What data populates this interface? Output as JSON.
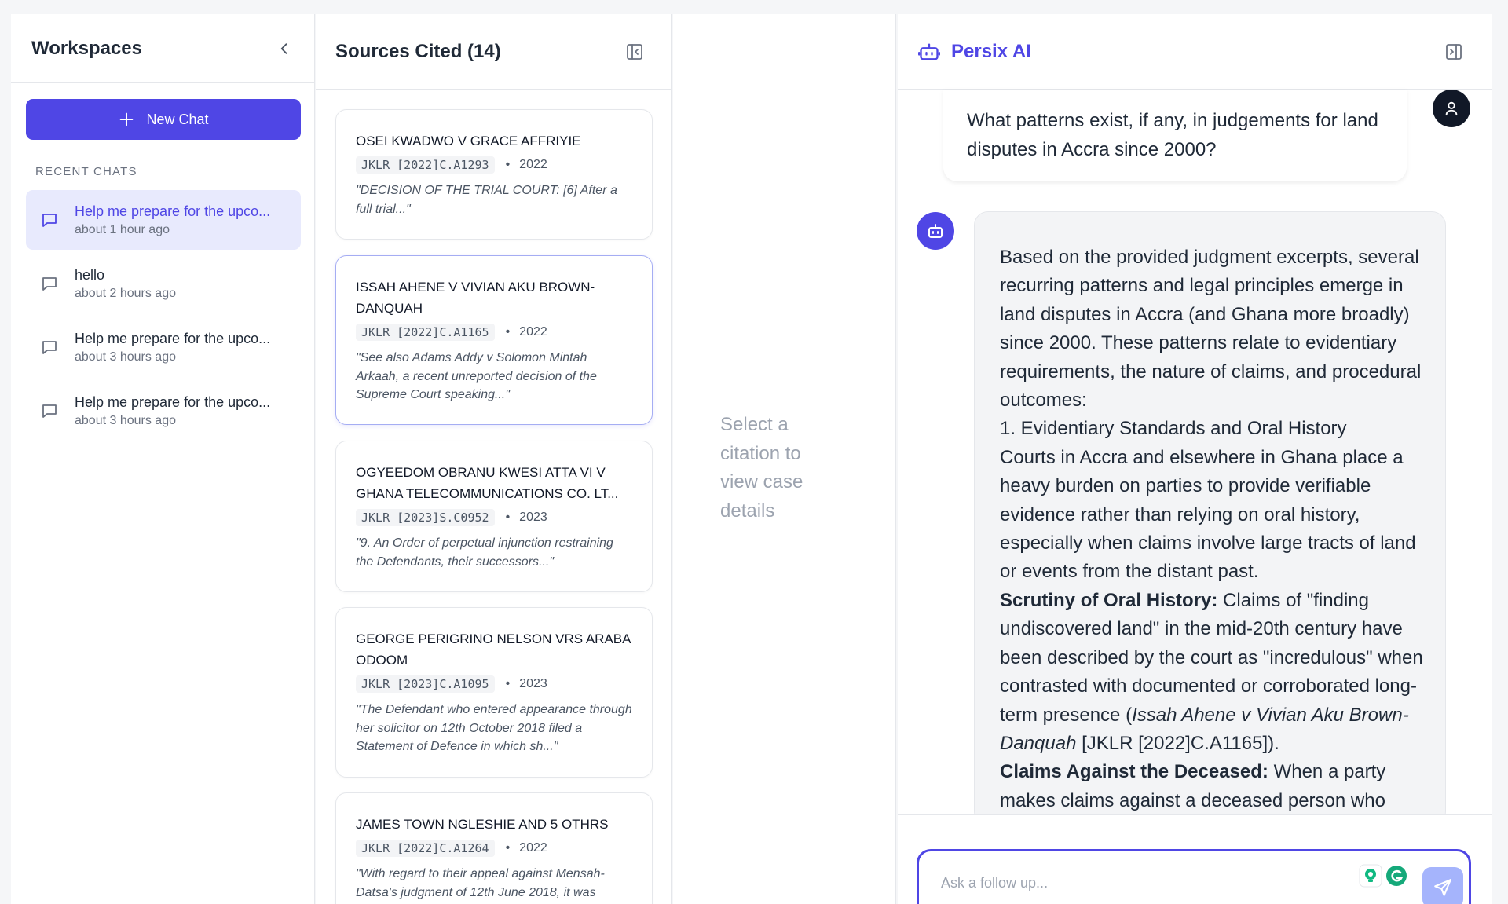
{
  "sidebar": {
    "title": "Workspaces",
    "new_chat_label": "New Chat",
    "recent_label": "RECENT CHATS",
    "chats": [
      {
        "title": "Help me prepare for the upco...",
        "time": "about 1 hour ago",
        "active": true
      },
      {
        "title": "hello",
        "time": "about 2 hours ago",
        "active": false
      },
      {
        "title": "Help me prepare for the upco...",
        "time": "about 3 hours ago",
        "active": false
      },
      {
        "title": "Help me prepare for the upco...",
        "time": "about 3 hours ago",
        "active": false
      }
    ]
  },
  "sources": {
    "title": "Sources Cited (14)",
    "cards": [
      {
        "title": "OSEI KWADWO V GRACE AFFRIYIE",
        "citation": "JKLR [2022]C.A1293",
        "year": "2022",
        "quote": "\"DECISION OF THE TRIAL COURT: [6] After a full trial...\""
      },
      {
        "title": "ISSAH AHENE V VIVIAN AKU BROWN-DANQUAH",
        "citation": "JKLR [2022]C.A1165",
        "year": "2022",
        "quote": "\"See also Adams Addy v Solomon Mintah Arkaah, a recent unreported decision of the Supreme Court speaking...\""
      },
      {
        "title": "OGYEEDOM OBRANU KWESI ATTA VI v GHANA TELECOMMUNICATIONS CO. LT...",
        "citation": "JKLR [2023]S.C0952",
        "year": "2023",
        "quote": "\"9. An Order of perpetual injunction restraining the Defendants, their successors...\""
      },
      {
        "title": "GEORGE PERIGRINO NELSON VRS ARABA ODOOM",
        "citation": "JKLR [2023]C.A1095",
        "year": "2023",
        "quote": "\"The Defendant who entered appearance through her solicitor on 12th October 2018 filed a Statement of Defence in which sh...\""
      },
      {
        "title": "JAMES TOWN NGLESHIE AND 5 OTHRS",
        "citation": "JKLR [2022]C.A1264",
        "year": "2022",
        "quote": "\"With regard to their appeal against Mensah-Datsa's judgment of 12th June 2018, it was"
      }
    ]
  },
  "detail": {
    "empty_message": "Select a citation to view case details"
  },
  "chat": {
    "brand": "Persix AI",
    "user_message": "What patterns exist, if any, in judgements for land disputes in Accra since 2000?",
    "answer": {
      "intro": "Based on the provided judgment excerpts, several recurring patterns and legal principles emerge in land disputes in Accra (and Ghana more broadly) since 2000. These patterns relate to evidentiary requirements, the nature of claims, and procedural outcomes:",
      "heading1": "1. Evidentiary Standards and Oral History",
      "para1": "Courts in Accra and elsewhere in Ghana place a heavy burden on parties to provide verifiable evidence rather than relying on oral history, especially when claims involve large tracts of land or events from the distant past.",
      "bold2": "Scrutiny of Oral History:",
      "para2a": " Claims of \"finding undiscovered land\" in the mid-20th century have been described by the court as \"incredulous\" when contrasted with documented or corroborated long-term presence (",
      "case2": "Issah Ahene v Vivian Aku Brown-Danquah",
      "para2b": " [JKLR [2022]C.A1165]).",
      "bold3": "Claims Against the Deceased:",
      "para3": " When a party makes claims against a deceased person who"
    },
    "composer_placeholder": "Ask a follow up..."
  },
  "colors": {
    "accent": "#4f46e5",
    "accent_light": "#e8eafd",
    "send_disabled": "#a5b4fc"
  }
}
